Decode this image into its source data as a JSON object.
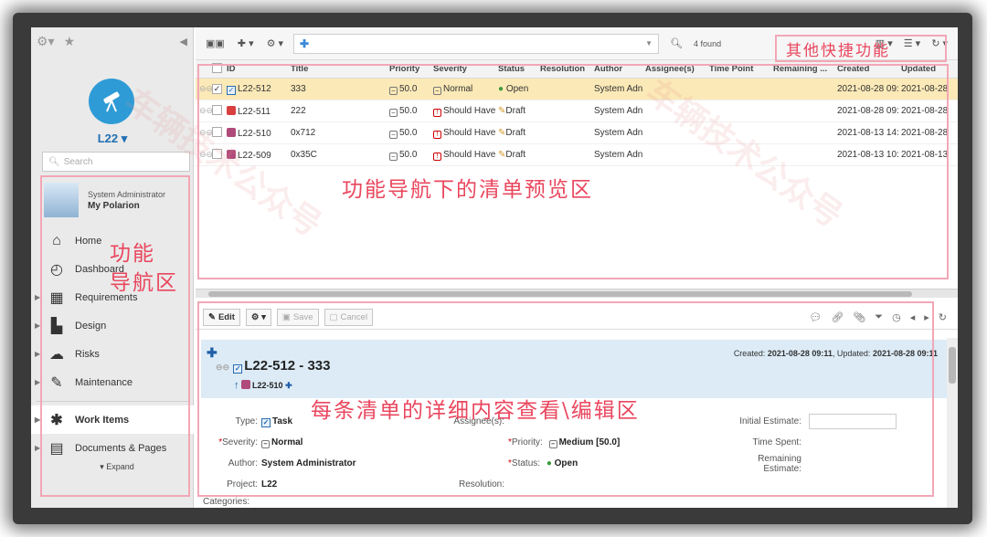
{
  "project": {
    "name": "L22 ▾"
  },
  "sidebar": {
    "search_placeholder": "Search",
    "user_line1": "System Administrator",
    "user_line2": "My Polarion",
    "items": [
      {
        "label": "Home",
        "icon": "home-icon"
      },
      {
        "label": "Dashboard",
        "icon": "dashboard-icon"
      },
      {
        "label": "Requirements",
        "icon": "requirements-icon"
      },
      {
        "label": "Design",
        "icon": "design-icon"
      },
      {
        "label": "Risks",
        "icon": "risks-icon"
      },
      {
        "label": "Maintenance",
        "icon": "maintenance-icon"
      },
      {
        "label": "Work Items",
        "icon": "work-items-icon"
      },
      {
        "label": "Documents & Pages",
        "icon": "documents-icon"
      }
    ],
    "expand": "▾ Expand"
  },
  "toolbar": {
    "query_symbol": "✚",
    "found": "4 found"
  },
  "table": {
    "columns": [
      "ID",
      "Title",
      "Priority",
      "Severity",
      "Status",
      "Resolution",
      "Author",
      "Assignee(s)",
      "Time Point",
      "Remaining ...",
      "Created",
      "Updated"
    ],
    "rows": [
      {
        "id": "L22-512",
        "title": "333",
        "priority": "50.0",
        "severity": "Normal",
        "status": "Open",
        "author": "System Adn",
        "created": "2021-08-28 09:",
        "updated": "2021-08-28",
        "checked": "✓"
      },
      {
        "id": "L22-511",
        "title": "222",
        "priority": "50.0",
        "severity": "Should Have",
        "status": "Draft",
        "author": "System Adn",
        "created": "2021-08-28 09:",
        "updated": "2021-08-28",
        "checked": ""
      },
      {
        "id": "L22-510",
        "title": "0x712",
        "priority": "50.0",
        "severity": "Should Have",
        "status": "Draft",
        "author": "System Adn",
        "created": "2021-08-13 14:",
        "updated": "2021-08-28",
        "checked": ""
      },
      {
        "id": "L22-509",
        "title": "0x35C",
        "priority": "50.0",
        "severity": "Should Have",
        "status": "Draft",
        "author": "System Adn",
        "created": "2021-08-13 10:",
        "updated": "2021-08-13",
        "checked": ""
      }
    ]
  },
  "detail": {
    "toolbar": {
      "edit": "Edit",
      "save": "Save",
      "cancel": "Cancel"
    },
    "title": "L22-512 - 333",
    "parent": "L22-510",
    "meta_created_label": "Created: ",
    "meta_created": "2021-08-28 09:11",
    "meta_updated_label": ", Updated: ",
    "meta_updated": "2021-08-28 09:11",
    "fields": {
      "type_label": "Type:",
      "type_value": "Task",
      "assignee_label": "Assignee(s):",
      "initial_estimate_label": "Initial Estimate:",
      "severity_label": "Severity:",
      "severity_value": "Normal",
      "priority_label": "Priority:",
      "priority_value": "Medium [50.0]",
      "time_spent_label": "Time Spent:",
      "author_label": "Author:",
      "author_value": "System Administrator",
      "status_label": "Status:",
      "status_value": "Open",
      "remaining_label": "Remaining Estimate:",
      "project_label": "Project:",
      "project_value": "L22",
      "resolution_label": "Resolution:",
      "categories_label": "Categories:"
    }
  },
  "annotations": {
    "quick": "其他快捷功能",
    "nav1": "功能",
    "nav2": "导航区",
    "list": "功能导航下的清单预览区",
    "detail": "每条清单的详细内容查看\\编辑区"
  },
  "watermark": "车辆技术公众号"
}
